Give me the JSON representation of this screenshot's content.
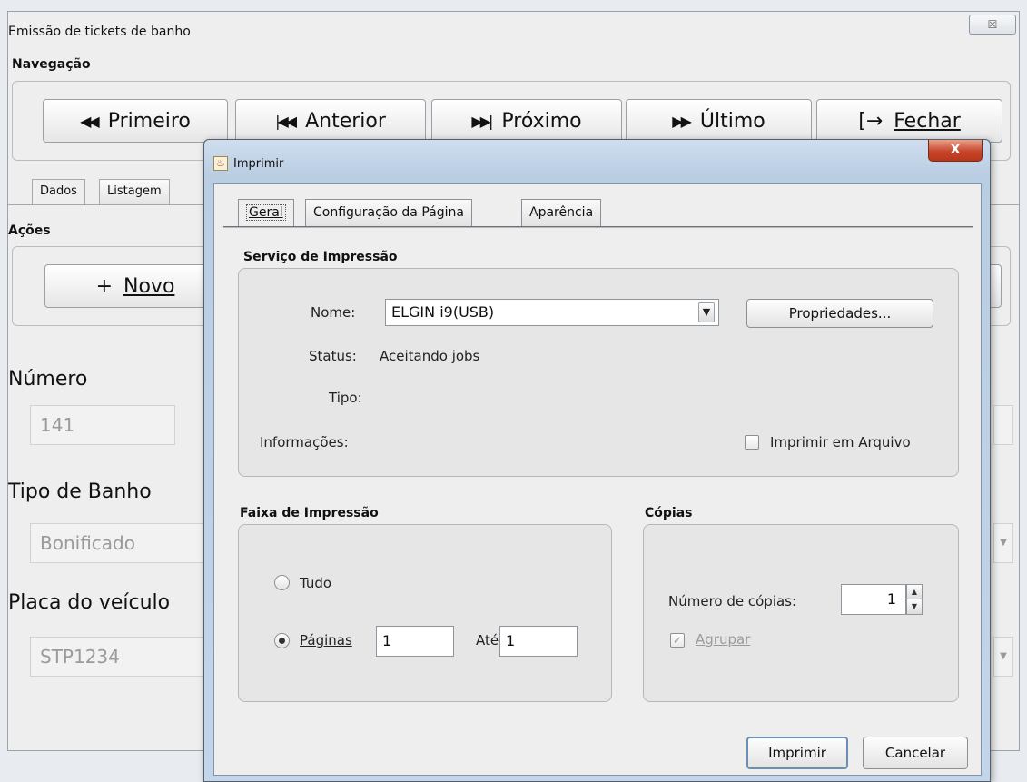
{
  "main_window": {
    "title": "Emissão de tickets de banho",
    "close_icon": "close-icon",
    "navigation": {
      "label": "Navegação",
      "buttons": [
        {
          "label": "Primeiro",
          "icon": "◀◀"
        },
        {
          "label": "Anterior",
          "icon": "|◀◀"
        },
        {
          "label": "Próximo",
          "icon": "▶▶|"
        },
        {
          "label": "Último",
          "icon": "▶▶"
        },
        {
          "label": "Fechar",
          "icon": "[→"
        }
      ]
    },
    "tabs": [
      "Dados",
      "Listagem"
    ],
    "actions": {
      "label": "Ações",
      "new_button": "Novo",
      "new_icon": "+"
    },
    "fields": [
      {
        "label": "Número",
        "value": "141"
      },
      {
        "label": "Tipo de Banho",
        "value": "Bonificado"
      },
      {
        "label": "Placa do veículo",
        "value": "STP1234"
      }
    ]
  },
  "dialog": {
    "title": "Imprimir",
    "tabs": [
      "Geral",
      "Configuração da Página",
      "Aparência"
    ],
    "print_service": {
      "label": "Serviço de Impressão",
      "name_label": "Nome:",
      "name_value": "ELGIN i9(USB)",
      "properties_button": "Propriedades...",
      "status_label": "Status:",
      "status_value": "Aceitando jobs",
      "type_label": "Tipo:",
      "info_label": "Informações:",
      "print_to_file": "Imprimir em Arquivo",
      "print_to_file_checked": false
    },
    "range": {
      "label": "Faixa de Impressão",
      "all": "Tudo",
      "pages": "Páginas",
      "from": "1",
      "to_label": "Até",
      "to": "1",
      "selected": "pages"
    },
    "copies": {
      "label": "Cópias",
      "count_label": "Número de cópias:",
      "count": "1",
      "collate": "Agrupar",
      "collate_checked": true,
      "collate_enabled": false
    },
    "buttons": {
      "print": "Imprimir",
      "cancel": "Cancelar"
    }
  }
}
